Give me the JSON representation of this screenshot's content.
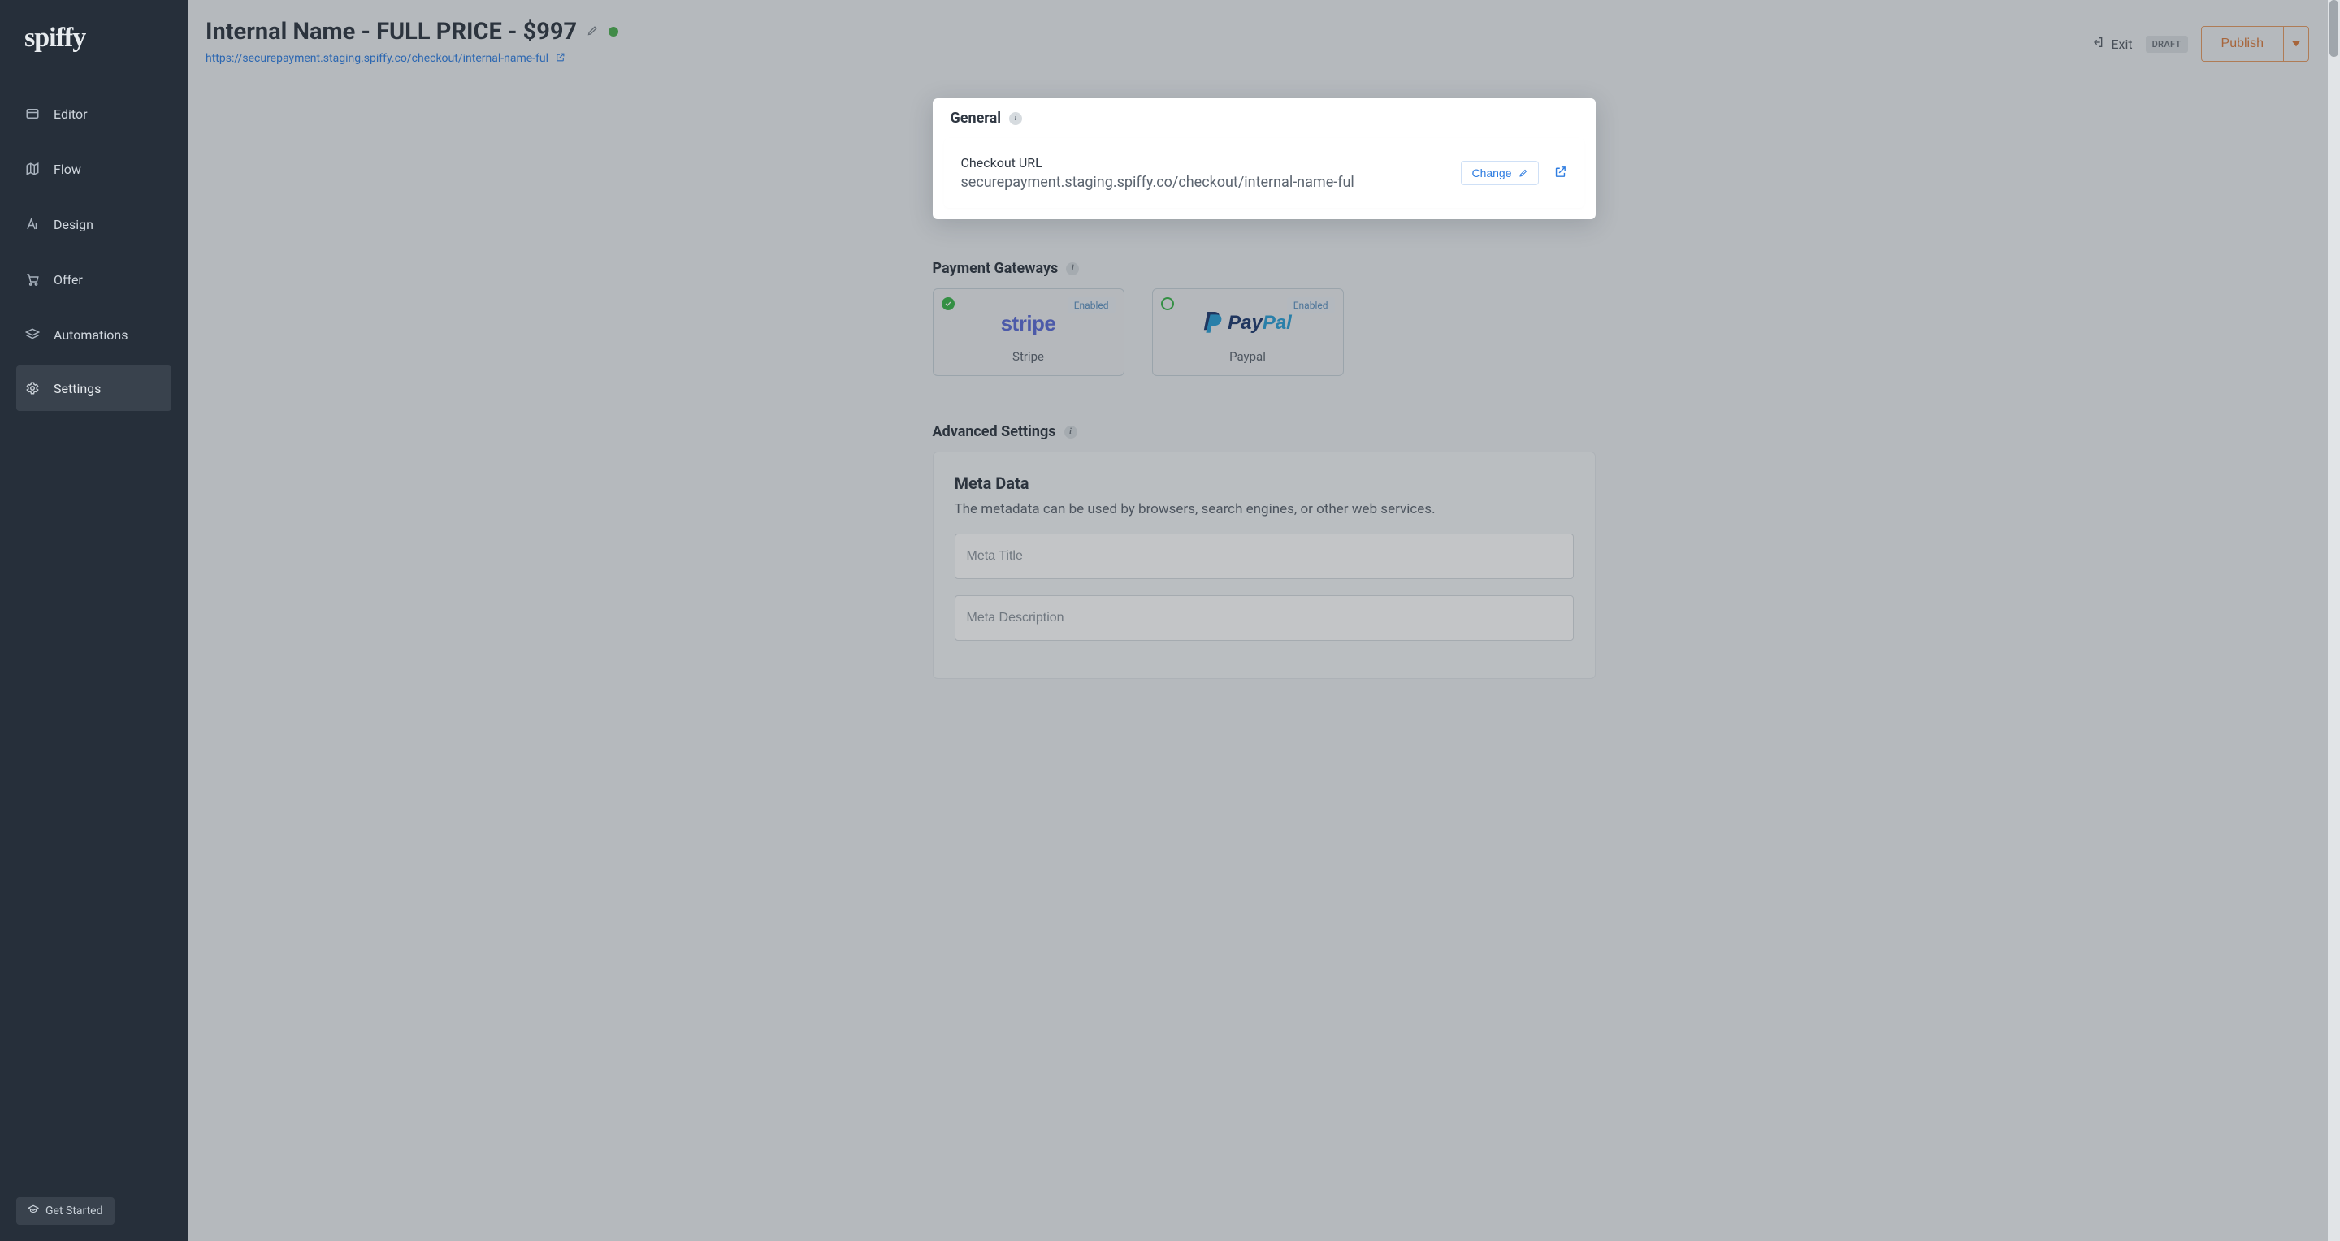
{
  "brand": "spiffy",
  "sidebar": {
    "items": [
      {
        "label": "Editor",
        "icon": "card-icon"
      },
      {
        "label": "Flow",
        "icon": "map-icon"
      },
      {
        "label": "Design",
        "icon": "typography-icon"
      },
      {
        "label": "Offer",
        "icon": "cart-icon"
      },
      {
        "label": "Automations",
        "icon": "layers-icon"
      },
      {
        "label": "Settings",
        "icon": "gear-icon"
      }
    ],
    "get_started": "Get Started"
  },
  "header": {
    "title": "Internal Name - FULL PRICE - $997",
    "url": "https://securepayment.staging.spiffy.co/checkout/internal-name-ful",
    "exit": "Exit",
    "draft_badge": "DRAFT",
    "publish": "Publish"
  },
  "sections": {
    "general": {
      "title": "General",
      "checkout_label": "Checkout URL",
      "checkout_url": "securepayment.staging.spiffy.co/checkout/internal-name-ful",
      "change": "Change"
    },
    "gateways": {
      "title": "Payment Gateways",
      "items": [
        {
          "name": "Stripe",
          "status": "Enabled",
          "logo": "stripe"
        },
        {
          "name": "Paypal",
          "status": "Enabled",
          "logo": "paypal"
        }
      ]
    },
    "advanced": {
      "title": "Advanced Settings",
      "meta_heading": "Meta Data",
      "meta_desc": "The metadata can be used by browsers, search engines, or other web services.",
      "meta_title_ph": "Meta Title",
      "meta_description_ph": "Meta Description"
    }
  }
}
